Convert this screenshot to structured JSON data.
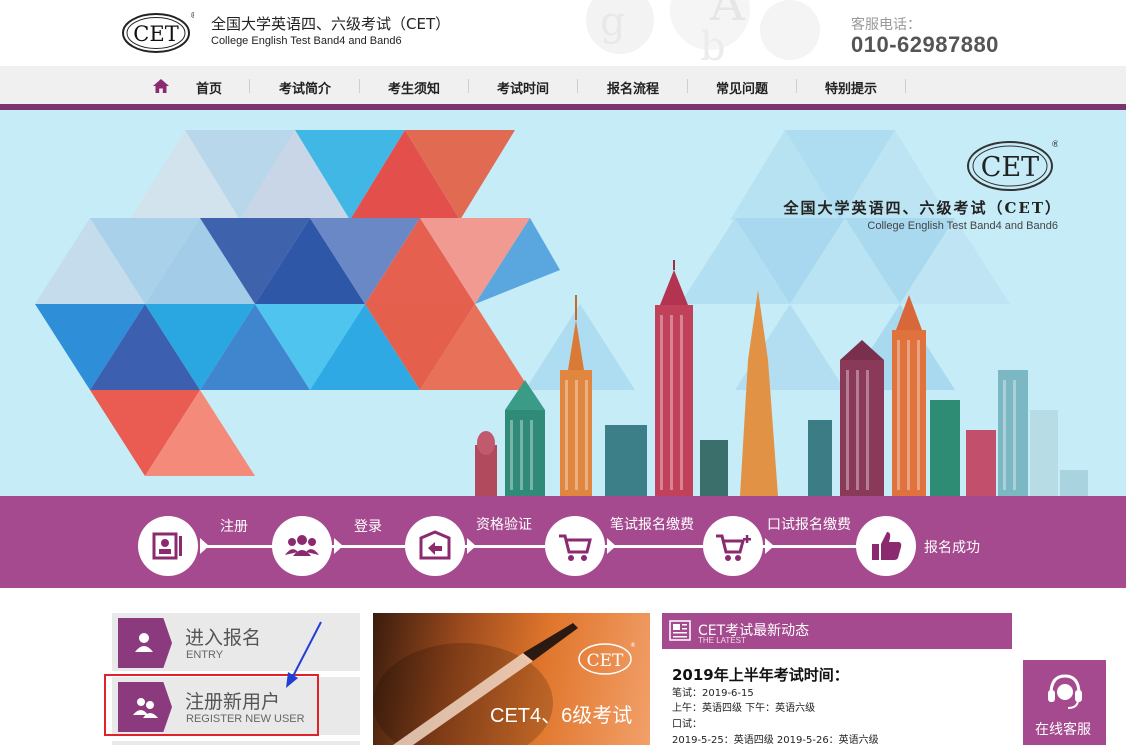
{
  "header": {
    "logo_text": "CET",
    "title_cn": "全国大学英语四、六级考试（CET）",
    "title_en": "College English Test Band4 and Band6",
    "phone_label": "客服电话：",
    "phone_number": "010-62987880"
  },
  "nav": {
    "home_icon": "home-icon",
    "items": [
      {
        "label": "首页"
      },
      {
        "label": "考试简介"
      },
      {
        "label": "考生须知"
      },
      {
        "label": "考试时间"
      },
      {
        "label": "报名流程"
      },
      {
        "label": "常见问题"
      },
      {
        "label": "特别提示"
      }
    ]
  },
  "banner": {
    "logo_text": "CET",
    "title_cn": "全国大学英语四、六级考试（CET）",
    "title_en": "College English Test Band4 and Band6"
  },
  "steps": [
    {
      "label": "注册",
      "icon": "register-icon"
    },
    {
      "label": "登录",
      "icon": "login-icon"
    },
    {
      "label": "资格验证",
      "icon": "verify-icon"
    },
    {
      "label": "笔试报名缴费",
      "icon": "cart-icon"
    },
    {
      "label": "口试报名缴费",
      "icon": "cart-plus-icon"
    },
    {
      "label": "报名成功",
      "icon": "thumbs-up-icon"
    }
  ],
  "entry": {
    "cn": "进入报名",
    "en": "ENTRY",
    "icon": "user-icon"
  },
  "register": {
    "cn": "注册新用户",
    "en": "REGISTER NEW USER",
    "icon": "users-icon"
  },
  "promo": {
    "logo_text": "CET",
    "text": "CET4、6级考试"
  },
  "news": {
    "title": "CET考试最新动态",
    "subtitle": "THE LATEST",
    "headline": "2019年上半年考试时间：",
    "lines": [
      "笔试：2019-6-15",
      "上午：英语四级    下午：英语六级",
      "口试：",
      "2019-5-25：英语四级    2019-5-26：英语六级"
    ]
  },
  "service": {
    "label": "在线客服",
    "icon": "headset-icon"
  },
  "colors": {
    "brand_purple": "#a64a8f",
    "nav_line": "#7b3470",
    "highlight_red": "#e0222b",
    "annotation_arrow": "#1f3fd6"
  }
}
